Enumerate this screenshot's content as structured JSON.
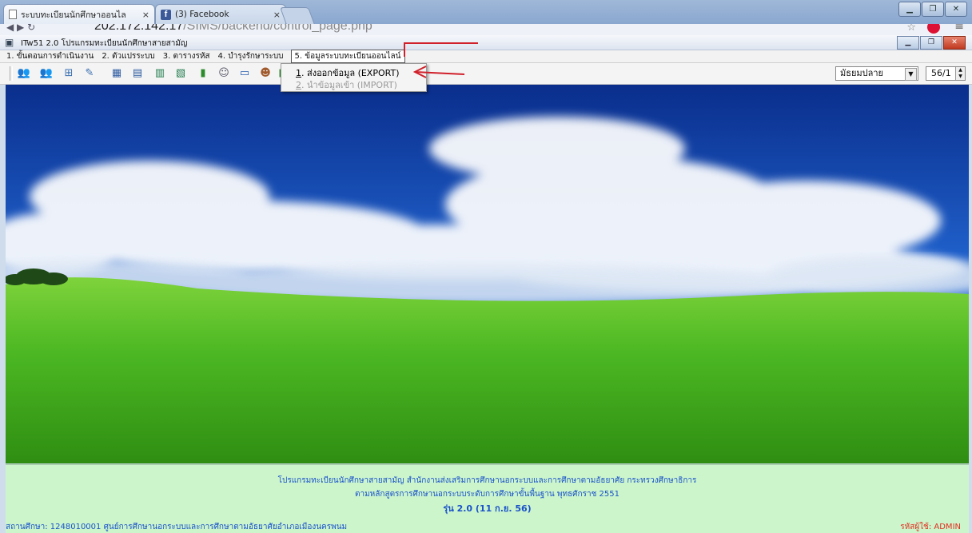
{
  "browser": {
    "tabs": [
      {
        "title": "ระบบทะเบียนนักศึกษาออนไล",
        "close": "×"
      },
      {
        "title": "(3) Facebook",
        "close": "×"
      }
    ],
    "url_host": "202.172.142.17",
    "url_path": "/SIMS/backend/control_page.php"
  },
  "app": {
    "title": "ITw51 2.0 โปรแกรมทะเบียนนักศึกษาสายสามัญ"
  },
  "menu": [
    "1. ขั้นตอนการดำเนินงาน",
    "2. ตัวแปรระบบ",
    "3. ตารางรหัส",
    "4. บำรุงรักษาระบบ",
    "5. ข้อมูลระบบทะเบียนออนไลน์"
  ],
  "dropdown": {
    "export_num": "1",
    "export_label": ". ส่งออกข้อมูล (EXPORT)",
    "import_num": "2",
    "import_label": ". นำข้อมูลเข้า (IMPORT)"
  },
  "toolbar": {
    "level": "มัธยมปลาย",
    "term": "56/1"
  },
  "footer": {
    "line1": "โปรแกรมทะเบียนนักศึกษาสายสามัญ สำนักงานส่งเสริมการศึกษานอกระบบและการศึกษาตามอัธยาศัย กระทรวงศึกษาธิการ",
    "line2": "ตามหลักสูตรการศึกษานอกระบบระดับการศึกษาขั้นพื้นฐาน พุทธศักราช 2551",
    "line3": "รุ่น 2.0 (11 ก.ย. 56)",
    "station": "สถานศึกษา: 1248010001  ศูนย์การศึกษานอกระบบและการศึกษาตามอัธยาศัยอำเภอเมืองนครพนม",
    "user": "รหัสผู้ใช้: ADMIN"
  },
  "colors": {
    "footer_bg": "#ccf5cc",
    "footer_text": "#1a52c9",
    "user_text": "#e03020",
    "annotation": "#d0202a"
  },
  "icons": [
    "users-icon",
    "users-edit-icon",
    "add-window-icon",
    "edit-window-icon",
    "table-icon",
    "table-edit-icon",
    "book-icon",
    "book-edit-icon",
    "chart-icon",
    "user-check-icon",
    "certificate-icon",
    "person-edit-icon",
    "sheet-icon"
  ]
}
